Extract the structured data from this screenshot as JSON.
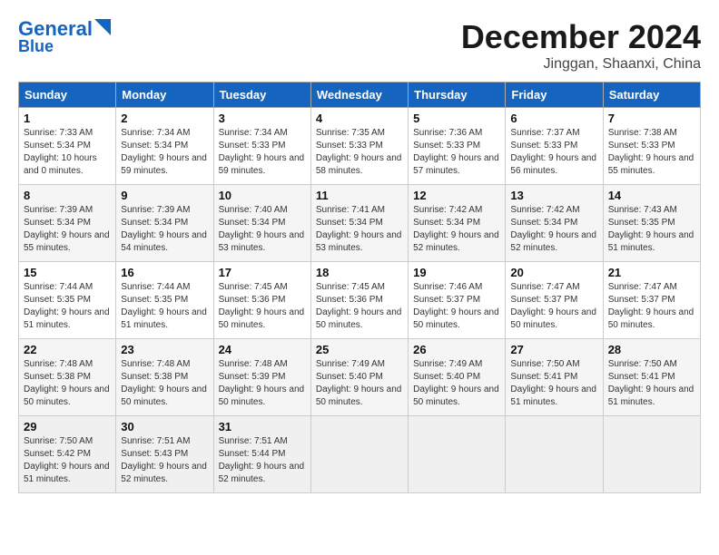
{
  "header": {
    "logo_line1": "General",
    "logo_line2": "Blue",
    "month": "December 2024",
    "location": "Jinggan, Shaanxi, China"
  },
  "weekdays": [
    "Sunday",
    "Monday",
    "Tuesday",
    "Wednesday",
    "Thursday",
    "Friday",
    "Saturday"
  ],
  "weeks": [
    [
      {
        "day": "1",
        "sunrise": "7:33 AM",
        "sunset": "5:34 PM",
        "daylight": "10 hours and 0 minutes."
      },
      {
        "day": "2",
        "sunrise": "7:34 AM",
        "sunset": "5:34 PM",
        "daylight": "9 hours and 59 minutes."
      },
      {
        "day": "3",
        "sunrise": "7:34 AM",
        "sunset": "5:33 PM",
        "daylight": "9 hours and 59 minutes."
      },
      {
        "day": "4",
        "sunrise": "7:35 AM",
        "sunset": "5:33 PM",
        "daylight": "9 hours and 58 minutes."
      },
      {
        "day": "5",
        "sunrise": "7:36 AM",
        "sunset": "5:33 PM",
        "daylight": "9 hours and 57 minutes."
      },
      {
        "day": "6",
        "sunrise": "7:37 AM",
        "sunset": "5:33 PM",
        "daylight": "9 hours and 56 minutes."
      },
      {
        "day": "7",
        "sunrise": "7:38 AM",
        "sunset": "5:33 PM",
        "daylight": "9 hours and 55 minutes."
      }
    ],
    [
      {
        "day": "8",
        "sunrise": "7:39 AM",
        "sunset": "5:34 PM",
        "daylight": "9 hours and 55 minutes."
      },
      {
        "day": "9",
        "sunrise": "7:39 AM",
        "sunset": "5:34 PM",
        "daylight": "9 hours and 54 minutes."
      },
      {
        "day": "10",
        "sunrise": "7:40 AM",
        "sunset": "5:34 PM",
        "daylight": "9 hours and 53 minutes."
      },
      {
        "day": "11",
        "sunrise": "7:41 AM",
        "sunset": "5:34 PM",
        "daylight": "9 hours and 53 minutes."
      },
      {
        "day": "12",
        "sunrise": "7:42 AM",
        "sunset": "5:34 PM",
        "daylight": "9 hours and 52 minutes."
      },
      {
        "day": "13",
        "sunrise": "7:42 AM",
        "sunset": "5:34 PM",
        "daylight": "9 hours and 52 minutes."
      },
      {
        "day": "14",
        "sunrise": "7:43 AM",
        "sunset": "5:35 PM",
        "daylight": "9 hours and 51 minutes."
      }
    ],
    [
      {
        "day": "15",
        "sunrise": "7:44 AM",
        "sunset": "5:35 PM",
        "daylight": "9 hours and 51 minutes."
      },
      {
        "day": "16",
        "sunrise": "7:44 AM",
        "sunset": "5:35 PM",
        "daylight": "9 hours and 51 minutes."
      },
      {
        "day": "17",
        "sunrise": "7:45 AM",
        "sunset": "5:36 PM",
        "daylight": "9 hours and 50 minutes."
      },
      {
        "day": "18",
        "sunrise": "7:45 AM",
        "sunset": "5:36 PM",
        "daylight": "9 hours and 50 minutes."
      },
      {
        "day": "19",
        "sunrise": "7:46 AM",
        "sunset": "5:37 PM",
        "daylight": "9 hours and 50 minutes."
      },
      {
        "day": "20",
        "sunrise": "7:47 AM",
        "sunset": "5:37 PM",
        "daylight": "9 hours and 50 minutes."
      },
      {
        "day": "21",
        "sunrise": "7:47 AM",
        "sunset": "5:37 PM",
        "daylight": "9 hours and 50 minutes."
      }
    ],
    [
      {
        "day": "22",
        "sunrise": "7:48 AM",
        "sunset": "5:38 PM",
        "daylight": "9 hours and 50 minutes."
      },
      {
        "day": "23",
        "sunrise": "7:48 AM",
        "sunset": "5:38 PM",
        "daylight": "9 hours and 50 minutes."
      },
      {
        "day": "24",
        "sunrise": "7:48 AM",
        "sunset": "5:39 PM",
        "daylight": "9 hours and 50 minutes."
      },
      {
        "day": "25",
        "sunrise": "7:49 AM",
        "sunset": "5:40 PM",
        "daylight": "9 hours and 50 minutes."
      },
      {
        "day": "26",
        "sunrise": "7:49 AM",
        "sunset": "5:40 PM",
        "daylight": "9 hours and 50 minutes."
      },
      {
        "day": "27",
        "sunrise": "7:50 AM",
        "sunset": "5:41 PM",
        "daylight": "9 hours and 51 minutes."
      },
      {
        "day": "28",
        "sunrise": "7:50 AM",
        "sunset": "5:41 PM",
        "daylight": "9 hours and 51 minutes."
      }
    ],
    [
      {
        "day": "29",
        "sunrise": "7:50 AM",
        "sunset": "5:42 PM",
        "daylight": "9 hours and 51 minutes."
      },
      {
        "day": "30",
        "sunrise": "7:51 AM",
        "sunset": "5:43 PM",
        "daylight": "9 hours and 52 minutes."
      },
      {
        "day": "31",
        "sunrise": "7:51 AM",
        "sunset": "5:44 PM",
        "daylight": "9 hours and 52 minutes."
      },
      null,
      null,
      null,
      null
    ]
  ]
}
